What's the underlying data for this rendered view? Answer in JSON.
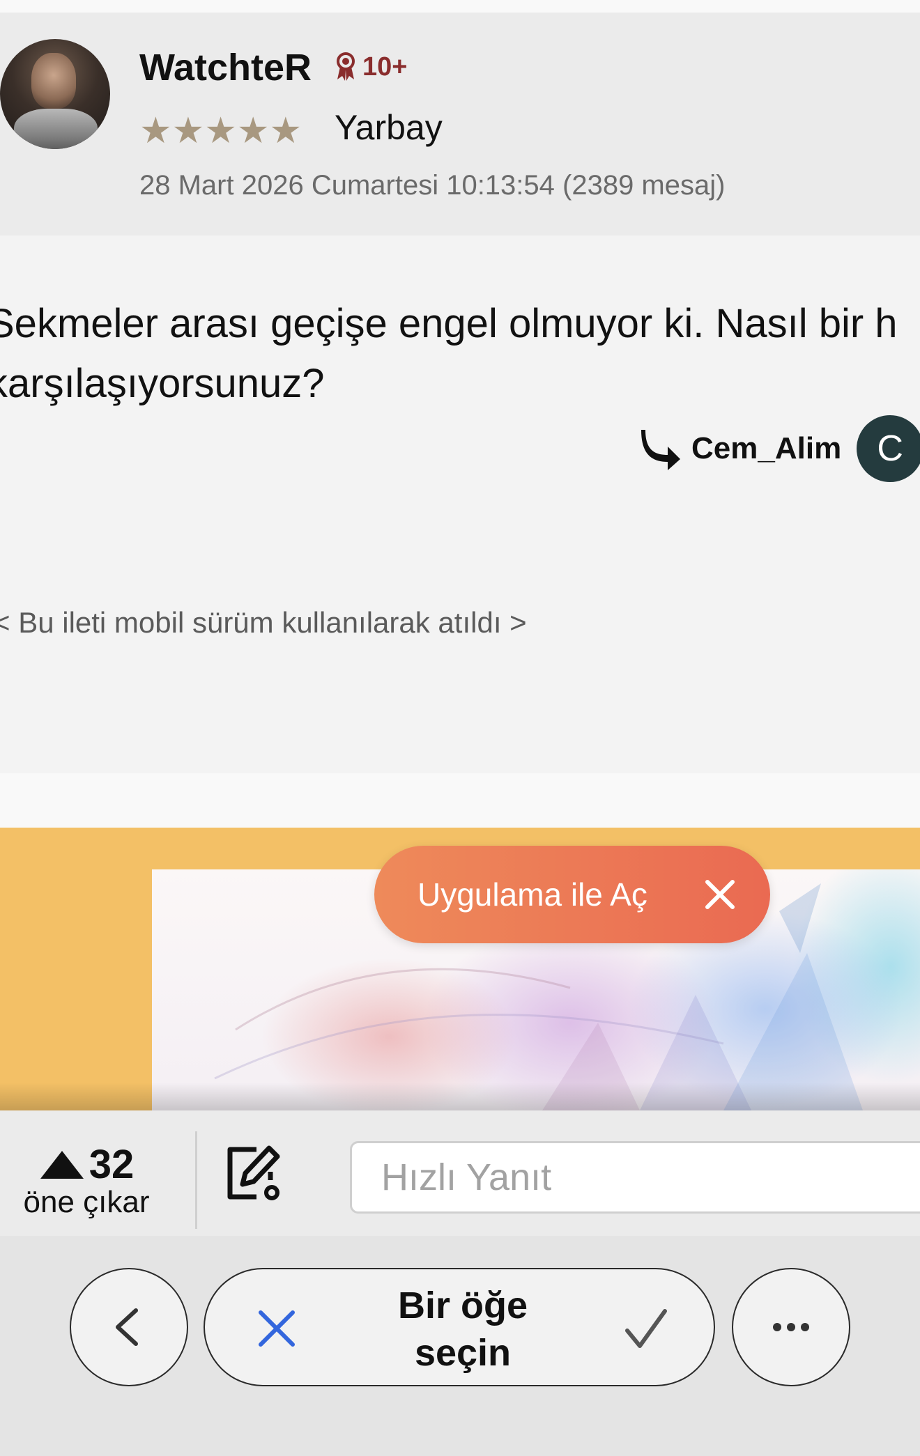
{
  "post": {
    "username": "WatchteR",
    "badge_count": "10+",
    "stars": "★★★★★",
    "rank": "Yarbay",
    "meta": "28 Mart 2026 Cumartesi 10:13:54 (2389 mesaj)",
    "message_line1": "Sekmeler arası geçişe engel olmuyor ki. Nasıl bir h",
    "message_line2": "karşılaşıyorsunuz?",
    "reply_to_name": "Cem_Alim",
    "reply_to_initial": "C",
    "mobile_note": "< Bu ileti mobil sürüm kullanılarak atıldı >"
  },
  "banner": {
    "open_app_label": "Uygulama ile Aç"
  },
  "toolbar": {
    "vote_count": "32",
    "vote_label": "öne çıkar",
    "quick_reply_placeholder": "Hızlı Yanıt",
    "pick_label_line1": "Bir öğe",
    "pick_label_line2": "seçin"
  },
  "icons": {
    "badge": "ribbon-icon",
    "reply": "reply-arrow-icon",
    "upvote": "triangle-up-icon",
    "edit": "edit-note-icon",
    "back": "chevron-left-icon",
    "cancel": "close-icon",
    "confirm": "checkmark-icon",
    "more": "more-horizontal-icon"
  },
  "colors": {
    "banner_bg": "#f3c066",
    "open_app_start": "#ee8a5a",
    "open_app_end": "#ea6a52",
    "badge": "#8a2d2d",
    "reply_avatar": "#243b3e",
    "cancel_icon": "#3366dd"
  }
}
